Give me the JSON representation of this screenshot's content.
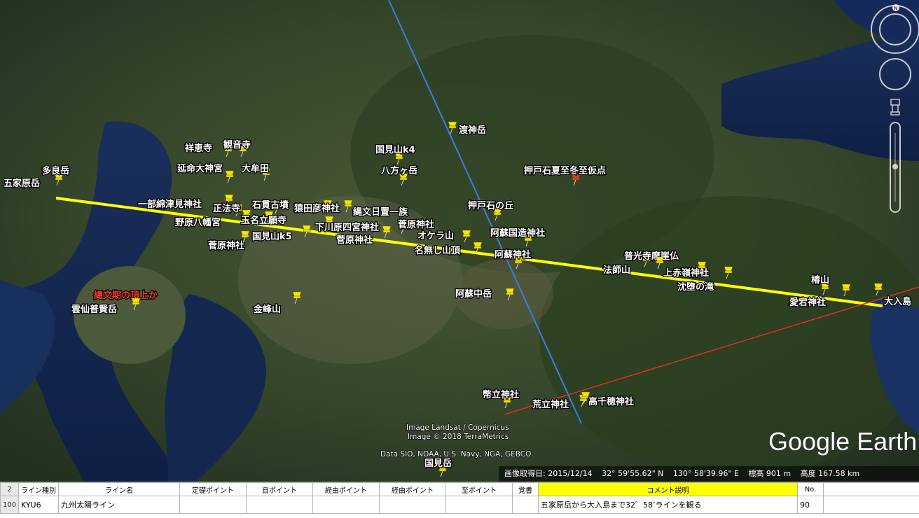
{
  "map": {
    "pins": [
      {
        "label": "多良岳"
      },
      {
        "label": "五家原岳"
      },
      {
        "label": "祥恵寺"
      },
      {
        "label": "観音寺"
      },
      {
        "label": "延命大神宮"
      },
      {
        "label": "大牟田"
      },
      {
        "label": "一部綿津見神社"
      },
      {
        "label": "正法寺"
      },
      {
        "label": "石貫古墳"
      },
      {
        "label": "猿田彦神社"
      },
      {
        "label": "縄文日置一族"
      },
      {
        "label": "野原八幡宮"
      },
      {
        "label": "玉名立願寺"
      },
      {
        "label": "下川原四宮神社"
      },
      {
        "label": "菅原神社"
      },
      {
        "label": "国見山k5"
      },
      {
        "label": "菅原神社"
      },
      {
        "label": "菅原神社"
      },
      {
        "label": "オケラ山"
      },
      {
        "label": "名無し山頂"
      },
      {
        "label": "国見山k4"
      },
      {
        "label": "八方ヶ岳"
      },
      {
        "label": "渡神岳"
      },
      {
        "label": "押戸石の丘"
      },
      {
        "label": "押戸石夏至冬至仮点"
      },
      {
        "label": "阿蘇国造神社"
      },
      {
        "label": "阿蘇神社"
      },
      {
        "label": "阿蘇中岳"
      },
      {
        "label": "普光寺摩崖仏"
      },
      {
        "label": "法師山"
      },
      {
        "label": "上赤嶺神社"
      },
      {
        "label": "沈堕の滝"
      },
      {
        "label": "椿山"
      },
      {
        "label": "愛宕神社"
      },
      {
        "label": "大入島"
      },
      {
        "label": "縄文期の頂上か"
      },
      {
        "label": "雲仙普賢岳"
      },
      {
        "label": "金峰山"
      },
      {
        "label": "幣立神社"
      },
      {
        "label": "荒立神社"
      },
      {
        "label": "高千穂神社"
      },
      {
        "label": "国見岳"
      }
    ],
    "credits": {
      "line1": "Image Landsat / Copernicus",
      "line2": "Image © 2018 TerraMetrics",
      "line3": "Data SIO, NOAA, U.S. Navy, NGA, GEBCO"
    },
    "logo": "Google Earth",
    "line_colors": {
      "yellow": "#ffff00",
      "blue": "#3a7fe0",
      "red": "#e0301e"
    },
    "pin_colors": {
      "default": "#f5e800",
      "special": "#e8361d"
    }
  },
  "statusbar": {
    "date": "画像取得日: 2015/12/14",
    "lat": "32° 59'55.62\" N",
    "lon": "130° 58'39.96\" E",
    "elevation": "標高   901 m",
    "altitude": "高度 167.58 km"
  },
  "sheet": {
    "header_row_num": "2",
    "headers": [
      "ライン種別",
      "ライン名",
      "定礎ポイント",
      "自ポイント",
      "経由ポイント",
      "経由ポイント",
      "至ポイント",
      "覚書",
      "コメント説明",
      "No."
    ],
    "row_num": "100",
    "row": [
      "KYU6",
      "九州太陽ライン",
      "",
      "",
      "",
      "",
      "",
      "",
      "五家原岳から大入島まで32゜58’ラインを観る",
      "90"
    ]
  }
}
